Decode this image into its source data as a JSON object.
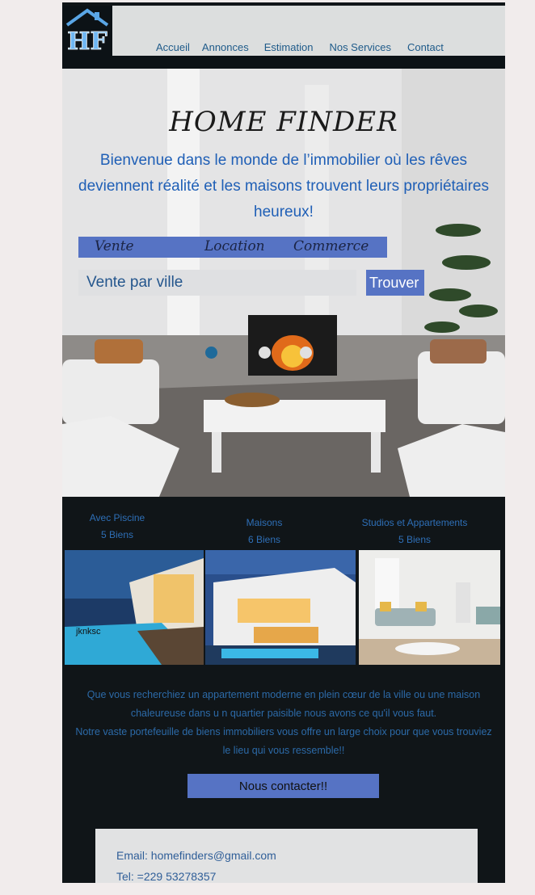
{
  "logo": {
    "text": "HF",
    "icon": "house-logo-icon"
  },
  "nav": {
    "items": [
      "Accueil",
      "Annonces",
      "Estimation",
      "Nos Services",
      "Contact"
    ]
  },
  "hero": {
    "title": "HOME FINDER",
    "tagline": "Bienvenue dans le monde de l’immobilier où les rêves deviennent réalité et les maisons trouvent leurs propriétaires heureux!",
    "tabs": [
      "Vente",
      "Location",
      "Commerce"
    ],
    "search": {
      "value": "Vente par ville",
      "button": "Trouver"
    }
  },
  "categories": [
    {
      "title": "Avec Piscine",
      "count": "5 Biens",
      "overlay": "jknksc"
    },
    {
      "title": "Maisons",
      "count": "6 Biens"
    },
    {
      "title": "Studios et Appartements",
      "count": "5 Biens"
    }
  ],
  "description": {
    "line1": "Que vous recherchiez un appartement moderne en plein cœur de la ville ou une maison chaleureuse dans u n quartier paisible nous avons ce qu'il vous faut.",
    "line2": "Notre vaste portefeuille de biens immobiliers vous offre un large choix pour que vous trouviez le lieu qui vous ressemble!!"
  },
  "cta": "Nous contacter!!",
  "contact": {
    "email": "Email: homefinders@gmail.com",
    "phone": "Tel: =229 53278357"
  },
  "colors": {
    "accent": "#5673c4",
    "dark": "#101518",
    "link": "#1f5b8a"
  }
}
